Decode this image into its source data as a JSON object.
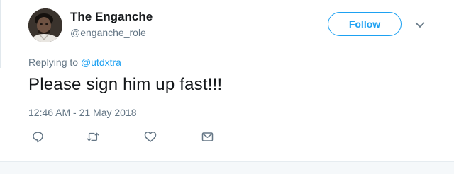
{
  "tweet": {
    "display_name": "The Enganche",
    "handle": "@enganche_role",
    "follow_label": "Follow",
    "replying_prefix": "Replying to",
    "replying_to": "@utdxtra",
    "text": "Please sign him up fast!!!",
    "timestamp": "12:46 AM - 21 May 2018"
  },
  "icons": {
    "more": "chevron-down-icon",
    "reply": "reply-icon",
    "retweet": "retweet-icon",
    "like": "heart-icon",
    "message": "envelope-icon"
  },
  "colors": {
    "accent": "#1da1f2",
    "text": "#14171a",
    "secondary": "#657786",
    "icon": "#657786",
    "border": "#e6ecf0"
  }
}
